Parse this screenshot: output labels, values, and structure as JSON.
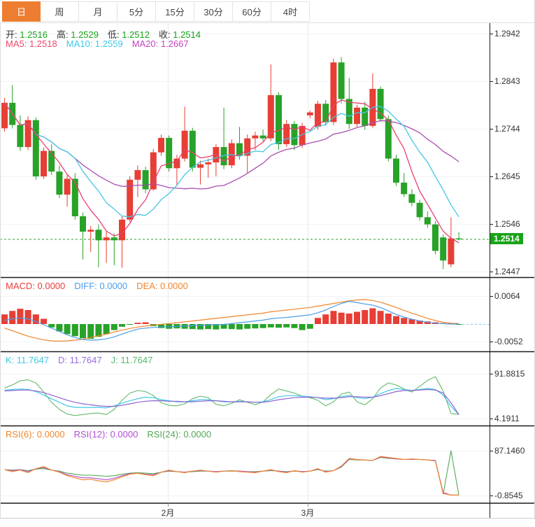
{
  "tabs": {
    "items": [
      {
        "label": "日",
        "active": true
      },
      {
        "label": "周",
        "active": false
      },
      {
        "label": "月",
        "active": false
      },
      {
        "label": "5分",
        "active": false
      },
      {
        "label": "15分",
        "active": false
      },
      {
        "label": "30分",
        "active": false
      },
      {
        "label": "60分",
        "active": false
      },
      {
        "label": "4时",
        "active": false
      }
    ]
  },
  "main": {
    "ohlc": [
      {
        "label": "开:",
        "value": "1.2516"
      },
      {
        "label": "高:",
        "value": "1.2529"
      },
      {
        "label": "低:",
        "value": "1.2512"
      },
      {
        "label": "收:",
        "value": "1.2514"
      }
    ],
    "ma": [
      {
        "label": "MA5:",
        "value": "1.2518",
        "color": "#ef476d"
      },
      {
        "label": "MA10:",
        "value": "1.2559",
        "color": "#3fc8e8"
      },
      {
        "label": "MA20:",
        "value": "1.2667",
        "color": "#c543c5"
      }
    ],
    "axis_labels": [
      "1.2942",
      "1.2843",
      "1.2744",
      "1.2645",
      "1.2546",
      "1.2447"
    ],
    "current_price": "1.2514"
  },
  "macd": {
    "legend": [
      {
        "label": "MACD:",
        "value": "0.0000",
        "color": "#e8403a"
      },
      {
        "label": "DIFF:",
        "value": "0.0000",
        "color": "#4a9de8"
      },
      {
        "label": "DEA:",
        "value": "0.0000",
        "color": "#f0862c"
      }
    ],
    "axis_labels": [
      "0.0064",
      "-0.0052"
    ]
  },
  "kdj": {
    "legend": [
      {
        "label": "K:",
        "value": "11.7647",
        "color": "#3fc8e8"
      },
      {
        "label": "D:",
        "value": "11.7647",
        "color": "#9a6ae0"
      },
      {
        "label": "J:",
        "value": "11.7647",
        "color": "#55b86a"
      }
    ],
    "axis_labels": [
      "91.8815",
      "4.1911"
    ]
  },
  "rsi": {
    "legend": [
      {
        "label": "RSI(6):",
        "value": "0.0000",
        "color": "#f0862c"
      },
      {
        "label": "RSI(12):",
        "value": "0.0000",
        "color": "#b44fd0"
      },
      {
        "label": "RSI(24):",
        "value": "0.0000",
        "color": "#55a855"
      }
    ],
    "axis_labels": [
      "87.1460",
      "-0.8545"
    ]
  },
  "xaxis": {
    "labels": [
      {
        "text": "2月",
        "x": 240
      },
      {
        "text": "3月",
        "x": 440
      }
    ]
  },
  "colors": {
    "up": "#e73e35",
    "down": "#28a228",
    "ma5": "#e8416d",
    "ma10": "#45c5e6",
    "ma20": "#a94fae",
    "diff": "#4a9de8",
    "dea": "#f0862c",
    "k": "#3fc8e8",
    "d": "#8f63cf",
    "j": "#62b96a",
    "rsi6": "#f0862c",
    "rsi12": "#b44fd0",
    "rsi24": "#55a855",
    "price_line": "#28a228",
    "price_tag_bg": "#18a318",
    "ohlc_value": "#18a318",
    "ohlc_label": "#333333",
    "tab_active_bg": "#ed7d31",
    "grid": "#f0f2f6",
    "vgrid": "#e9e9ef",
    "axis": "#1a1a1a"
  },
  "chart_data": {
    "type": "candlestick",
    "title": "",
    "x_axis": {
      "labels": [
        "2月",
        "3月"
      ],
      "gridline_x": [
        240,
        440
      ]
    },
    "main": {
      "ylim": [
        1.2447,
        1.2942
      ],
      "gridline_values": [
        1.2942,
        1.2843,
        1.2744,
        1.2645,
        1.2546,
        1.2447
      ],
      "current_price": 1.2514,
      "ma_periods": [
        5,
        10,
        20
      ],
      "candles_ohlc": [
        [
          1.2745,
          1.2808,
          1.2738,
          1.2798
        ],
        [
          1.2798,
          1.2835,
          1.2745,
          1.2752
        ],
        [
          1.2752,
          1.2772,
          1.2698,
          1.2706
        ],
        [
          1.2706,
          1.277,
          1.27,
          1.2762
        ],
        [
          1.2762,
          1.2768,
          1.2638,
          1.2645
        ],
        [
          1.2645,
          1.2705,
          1.264,
          1.2698
        ],
        [
          1.2698,
          1.2712,
          1.2648,
          1.2655
        ],
        [
          1.2655,
          1.2668,
          1.26,
          1.2607
        ],
        [
          1.2607,
          1.2648,
          1.2582,
          1.264
        ],
        [
          1.264,
          1.2652,
          1.2555,
          1.2562
        ],
        [
          1.2562,
          1.257,
          1.2472,
          1.253
        ],
        [
          1.253,
          1.2542,
          1.2488,
          1.2534
        ],
        [
          1.2534,
          1.2545,
          1.2456,
          1.2512
        ],
        [
          1.2512,
          1.253,
          1.2465,
          1.2518
        ],
        [
          1.2518,
          1.2526,
          1.246,
          1.2512
        ],
        [
          1.2512,
          1.2562,
          1.2455,
          1.2555
        ],
        [
          1.2555,
          1.2645,
          1.255,
          1.2638
        ],
        [
          1.2638,
          1.2668,
          1.2602,
          1.2658
        ],
        [
          1.2658,
          1.2665,
          1.261,
          1.2618
        ],
        [
          1.2618,
          1.2702,
          1.2615,
          1.2695
        ],
        [
          1.2695,
          1.2732,
          1.2688,
          1.2725
        ],
        [
          1.2725,
          1.273,
          1.2655,
          1.2662
        ],
        [
          1.2662,
          1.269,
          1.2625,
          1.2682
        ],
        [
          1.2682,
          1.279,
          1.2676,
          1.274
        ],
        [
          1.274,
          1.2746,
          1.2655,
          1.2663
        ],
        [
          1.2663,
          1.2678,
          1.2628,
          1.267
        ],
        [
          1.267,
          1.2682,
          1.2642,
          1.2674
        ],
        [
          1.2674,
          1.2712,
          1.2645,
          1.2706
        ],
        [
          1.2706,
          1.2788,
          1.266,
          1.2668
        ],
        [
          1.2668,
          1.2722,
          1.2662,
          1.2714
        ],
        [
          1.2714,
          1.2748,
          1.268,
          1.2688
        ],
        [
          1.2688,
          1.2732,
          1.2652,
          1.2724
        ],
        [
          1.2724,
          1.2738,
          1.27,
          1.273
        ],
        [
          1.273,
          1.2742,
          1.2718,
          1.2724
        ],
        [
          1.2724,
          1.2878,
          1.2718,
          1.2814
        ],
        [
          1.2814,
          1.282,
          1.27,
          1.2712
        ],
        [
          1.2712,
          1.2762,
          1.2706,
          1.2754
        ],
        [
          1.2754,
          1.276,
          1.27,
          1.271
        ],
        [
          1.271,
          1.2756,
          1.2704,
          1.275
        ],
        [
          1.2772,
          1.2782,
          1.2766,
          1.2778
        ],
        [
          1.2748,
          1.2802,
          1.2742,
          1.2796
        ],
        [
          1.2796,
          1.2804,
          1.275,
          1.2758
        ],
        [
          1.2758,
          1.289,
          1.2752,
          1.2882
        ],
        [
          1.2882,
          1.2893,
          1.2797,
          1.2806
        ],
        [
          1.2806,
          1.285,
          1.2744,
          1.2754
        ],
        [
          1.2754,
          1.2794,
          1.2748,
          1.2788
        ],
        [
          1.2788,
          1.28,
          1.2742,
          1.275
        ],
        [
          1.275,
          1.2859,
          1.2746,
          1.2827
        ],
        [
          1.2827,
          1.2832,
          1.2758,
          1.2764
        ],
        [
          1.2764,
          1.2772,
          1.2676,
          1.2682
        ],
        [
          1.2682,
          1.269,
          1.2625,
          1.2632
        ],
        [
          1.2632,
          1.2652,
          1.2602,
          1.2608
        ],
        [
          1.2608,
          1.2618,
          1.2583,
          1.259
        ],
        [
          1.259,
          1.2596,
          1.2553,
          1.256
        ],
        [
          1.256,
          1.2572,
          1.2538,
          1.2545
        ],
        [
          1.2545,
          1.2552,
          1.2483,
          1.249
        ],
        [
          1.2518,
          1.2524,
          1.2452,
          1.247
        ],
        [
          1.2462,
          1.256,
          1.2456,
          1.2516
        ],
        [
          1.2516,
          1.2529,
          1.2512,
          1.2514
        ]
      ]
    },
    "macd": {
      "gridline_values": [
        0.0064,
        -0.0052
      ],
      "hist": [
        0.0022,
        0.003,
        0.0035,
        0.0032,
        0.0022,
        0.0012,
        -0.001,
        -0.0022,
        -0.003,
        -0.0036,
        -0.0042,
        -0.0044,
        -0.0038,
        -0.003,
        -0.0018,
        -0.0008,
        -0.0002,
        0.0003,
        0.0004,
        -0.0006,
        -0.0012,
        -0.0014,
        -0.0013,
        -0.0014,
        -0.0015,
        -0.0016,
        -0.0015,
        -0.0016,
        -0.0014,
        -0.0015,
        -0.0016,
        -0.0014,
        -0.0013,
        -0.0012,
        -0.001,
        -0.0011,
        -0.001,
        -0.0012,
        -0.0018,
        -0.0014,
        0.0014,
        0.0022,
        0.003,
        0.0026,
        0.0024,
        0.0028,
        0.0032,
        0.0036,
        0.003,
        0.0024,
        0.0018,
        0.0014,
        0.0011,
        0.0008,
        0.0006,
        0.0004,
        0.0002,
        0.0001,
        -0.0001
      ],
      "diff": [
        0.0008,
        0.0012,
        0.0014,
        0.0012,
        0.0006,
        -0.0002,
        -0.0012,
        -0.0022,
        -0.0032,
        -0.004,
        -0.0046,
        -0.0048,
        -0.0047,
        -0.0044,
        -0.0038,
        -0.003,
        -0.0022,
        -0.0015,
        -0.0012,
        -0.001,
        -0.0009,
        -0.0008,
        -0.0007,
        -0.0006,
        -0.0005,
        -0.0004,
        -0.0003,
        -0.0002,
        -0.0001,
        0.0001,
        0.0003,
        0.0005,
        0.0007,
        0.0009,
        0.0012,
        0.0014,
        0.0015,
        0.0017,
        0.0019,
        0.0021,
        0.0026,
        0.0032,
        0.004,
        0.0047,
        0.0052,
        0.0049,
        0.0046,
        0.0043,
        0.0038,
        0.003,
        0.0022,
        0.0016,
        0.0011,
        0.0007,
        0.0004,
        0.0002,
        0.0001,
        0.0,
        0.0
      ],
      "dea": [
        -0.0012,
        -0.002,
        -0.0028,
        -0.0036,
        -0.0042,
        -0.0047,
        -0.005,
        -0.0051,
        -0.005,
        -0.0048,
        -0.0045,
        -0.004,
        -0.0035,
        -0.003,
        -0.0024,
        -0.0018,
        -0.0013,
        -0.0009,
        -0.0006,
        -0.0003,
        -0.0001,
        0.0001,
        0.0003,
        0.0005,
        0.0007,
        0.0009,
        0.0011,
        0.0013,
        0.0015,
        0.0017,
        0.0019,
        0.0021,
        0.0023,
        0.0025,
        0.0028,
        0.003,
        0.0032,
        0.0034,
        0.0036,
        0.0038,
        0.0041,
        0.0044,
        0.0047,
        0.005,
        0.0053,
        0.0055,
        0.0056,
        0.0054,
        0.005,
        0.0044,
        0.0038,
        0.0031,
        0.0025,
        0.0019,
        0.0013,
        0.0008,
        0.0004,
        0.0002,
        0.0001
      ]
    },
    "kdj": {
      "gridline_values": [
        91.8815,
        4.1911
      ],
      "k": [
        60,
        61,
        62,
        61,
        57,
        50,
        43,
        36,
        29,
        26,
        26,
        26,
        26,
        25,
        29,
        34,
        39,
        43,
        46,
        45,
        41,
        39,
        37,
        37,
        39,
        41,
        41,
        39,
        37,
        37,
        38,
        37,
        36,
        37,
        41,
        47,
        49,
        49,
        48,
        47,
        45,
        41,
        43,
        47,
        49,
        45,
        43,
        46,
        53,
        59,
        63,
        61,
        59,
        61,
        63,
        61,
        50,
        28,
        12
      ],
      "d": [
        58,
        59,
        60,
        60,
        58,
        55,
        50,
        45,
        40,
        36,
        33,
        31,
        29,
        28,
        28,
        30,
        33,
        36,
        38,
        39,
        39,
        38,
        38,
        37,
        37,
        38,
        39,
        39,
        38,
        37,
        37,
        37,
        36,
        36,
        38,
        41,
        43,
        45,
        46,
        46,
        45,
        44,
        44,
        45,
        47,
        47,
        46,
        46,
        49,
        53,
        57,
        59,
        59,
        60,
        61,
        60,
        54,
        35,
        12
      ],
      "j": [
        64,
        70,
        78,
        80,
        74,
        56,
        36,
        22,
        13,
        10,
        12,
        14,
        15,
        12,
        22,
        40,
        54,
        59,
        57,
        49,
        35,
        30,
        29,
        33,
        43,
        48,
        45,
        32,
        29,
        34,
        41,
        36,
        31,
        37,
        51,
        62,
        58,
        54,
        48,
        45,
        40,
        29,
        37,
        52,
        56,
        37,
        31,
        43,
        64,
        74,
        70,
        62,
        56,
        67,
        79,
        86,
        58,
        14,
        12
      ]
    },
    "rsi": {
      "gridline_values": [
        87.146,
        -0.8545
      ],
      "rsi6": [
        50,
        46,
        49,
        44,
        52,
        56,
        49,
        45,
        38,
        34,
        30,
        31,
        28,
        26,
        30,
        36,
        41,
        43,
        40,
        38,
        45,
        49,
        46,
        44,
        47,
        49,
        47,
        45,
        47,
        48,
        46,
        45,
        44,
        47,
        50,
        46,
        44,
        48,
        45,
        47,
        52,
        45,
        48,
        57,
        72,
        70,
        69,
        68,
        76,
        74,
        72,
        70,
        71,
        70,
        69,
        67,
        3,
        0,
        0
      ],
      "rsi12": [
        50,
        48,
        50,
        46,
        52,
        54,
        49,
        46,
        40,
        37,
        34,
        34,
        32,
        30,
        33,
        38,
        42,
        43,
        41,
        40,
        45,
        48,
        46,
        45,
        47,
        48,
        47,
        46,
        47,
        48,
        47,
        46,
        45,
        47,
        49,
        47,
        45,
        48,
        46,
        47,
        51,
        46,
        48,
        56,
        71,
        70,
        69,
        68,
        75,
        73,
        71,
        70,
        70,
        70,
        69,
        68,
        5,
        0,
        0
      ],
      "rsi24": [
        50,
        49,
        50,
        48,
        51,
        52,
        49,
        47,
        43,
        41,
        39,
        39,
        38,
        37,
        38,
        41,
        43,
        44,
        43,
        42,
        45,
        47,
        46,
        45,
        46,
        47,
        47,
        46,
        47,
        47,
        47,
        46,
        46,
        47,
        48,
        47,
        46,
        47,
        46,
        47,
        50,
        47,
        48,
        55,
        70,
        69,
        69,
        68,
        74,
        72,
        71,
        70,
        70,
        70,
        69,
        68,
        2,
        87,
        0
      ]
    }
  }
}
